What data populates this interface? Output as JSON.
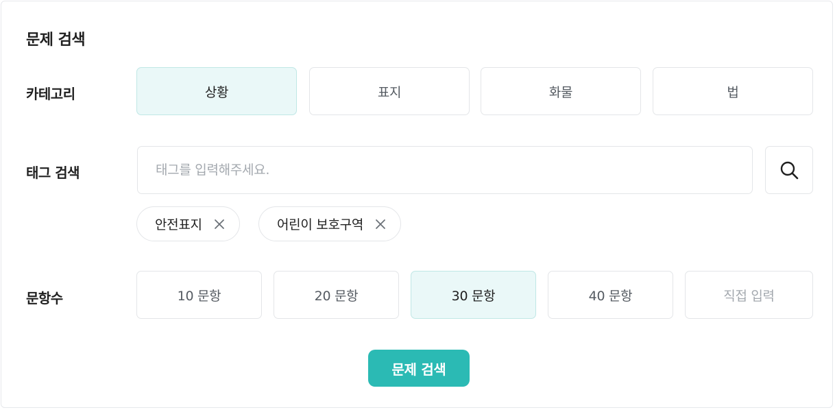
{
  "panel": {
    "title": "문제 검색"
  },
  "category": {
    "label": "카테고리",
    "options": [
      "상황",
      "표지",
      "화물",
      "법"
    ],
    "selected": "상황"
  },
  "tag_search": {
    "label": "태그 검색",
    "placeholder": "태그를 입력해주세요.",
    "value": "",
    "search_icon": "search-icon",
    "chips": [
      {
        "label": "안전표지",
        "remove_icon": "close-icon"
      },
      {
        "label": "어린이 보호구역",
        "remove_icon": "close-icon"
      }
    ]
  },
  "question_count": {
    "label": "문항수",
    "options": [
      "10 문항",
      "20 문항",
      "30 문항",
      "40 문항"
    ],
    "selected": "30 문항",
    "custom_placeholder": "직접 입력"
  },
  "submit": {
    "label": "문제 검색"
  },
  "colors": {
    "accent": "#2bbab4",
    "selected_bg": "#eaf8f8",
    "selected_border": "#bfe7e5",
    "border": "#e3e5e8",
    "text": "#1f1f1f",
    "muted_text": "#a3a8ae"
  }
}
